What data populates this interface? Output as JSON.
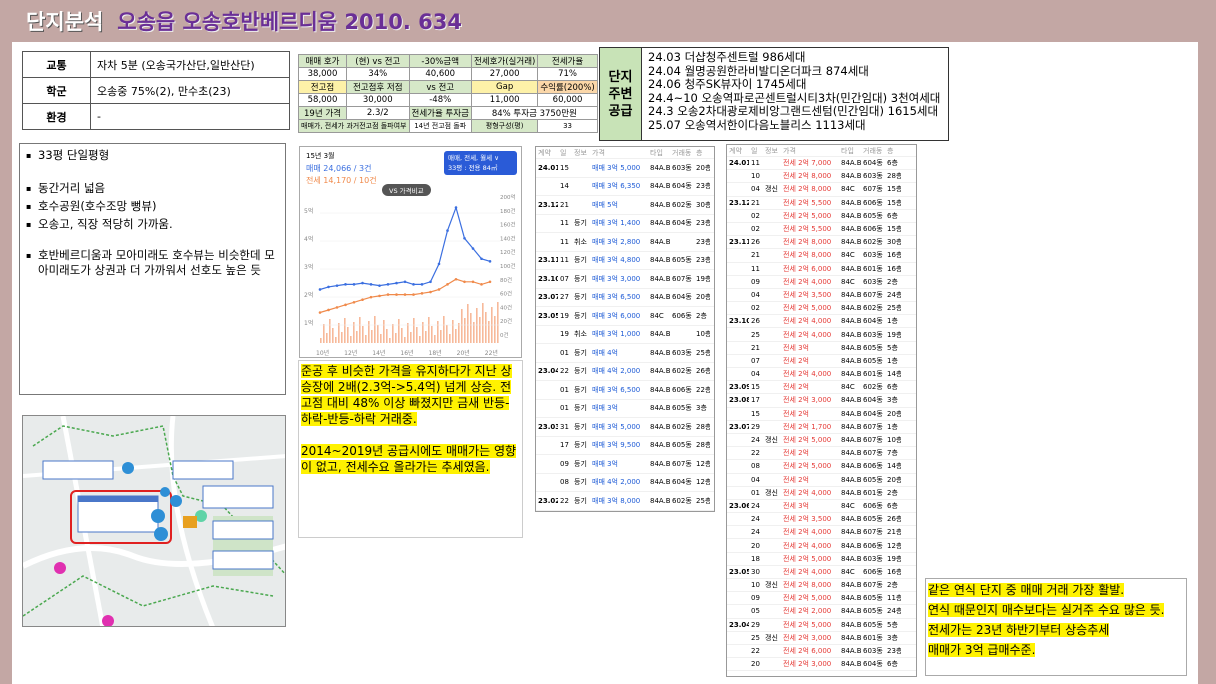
{
  "title": {
    "main": "단지분석",
    "sub": "오송읍 오송호반베르디움 2010. 634"
  },
  "info": [
    {
      "key": "교통",
      "value": "자차 5분 (오송국가산단,일반산단)"
    },
    {
      "key": "학군",
      "value": "오송중 75%(2), 만수초(23)"
    },
    {
      "key": "환경",
      "value": "-"
    }
  ],
  "price_table": {
    "r1": [
      "매매 호가",
      "(현) vs 전고",
      "-30%금액",
      "전세호가(실거래)",
      "전세가율"
    ],
    "r2": [
      "38,000",
      "34%",
      "40,600",
      "27,000",
      "71%"
    ],
    "r3": [
      "전고점",
      "전고점후 저점",
      "vs 전고",
      "Gap",
      "수익률(200%)"
    ],
    "r4": [
      "58,000",
      "30,000",
      "-48%",
      "11,000",
      "60,000"
    ],
    "r5": [
      "19년 가격",
      "2.3/2",
      "전세가율 투자금",
      "84% 투자금 3750만원"
    ],
    "r6": [
      "매매가, 전세가 과거전고점 돌파여부",
      "14년 전고점 돌파",
      "평형구성(평)",
      "33"
    ]
  },
  "supply": {
    "head": [
      "단지",
      "주변",
      "공급"
    ],
    "items": [
      "24.03 더샵청주센트럴 986세대",
      "24.04 월명공원한라비발디온더파크 874세대",
      "24.06 청주SK뷰자이 1745세대",
      "24.4~10 오송역파로곤센트럴시티3차(민간임대) 3천여세대",
      "24.3 오송2차대광로제비앙그랜드센텀(민간임대) 1615세대",
      "25.07 오송역서한이다음노블리스 1113세대"
    ]
  },
  "notes": [
    "33평 단일평형",
    "동간거리 넓음",
    "호수공원(호수조망 뻥뷰)",
    "오송고, 직장 적당히 가까움.",
    "호반베르디움과 모아미래도 호수뷰는 비슷한데 모아미래도가 상권과 더 가까워서 선호도 높은 듯"
  ],
  "chart": {
    "date": "15년 3월",
    "sale": "매매 24,066 / 3건",
    "jeonse": "전세 14,170 / 10건",
    "filter": "매매, 전세, 월세 ∨",
    "filter2": "33평 : 전용 84㎡",
    "compare": "VS 가격비교"
  },
  "chart_data": {
    "type": "line",
    "title": "",
    "x_ticks": [
      "10년",
      "12년",
      "14년",
      "16년",
      "18년",
      "20년",
      "22년"
    ],
    "y_left_ticks": [
      "5억",
      "4억",
      "3억",
      "2억",
      "1억"
    ],
    "y_right_ticks": [
      "200억",
      "180건",
      "160건",
      "140건",
      "120건",
      "100건",
      "80건",
      "60건",
      "40건",
      "20건",
      "0건"
    ],
    "series": [
      {
        "name": "매매",
        "color": "#3b6fe0",
        "values": [
          2.2,
          2.3,
          2.35,
          2.4,
          2.4,
          2.45,
          2.4,
          2.35,
          2.4,
          2.45,
          2.5,
          2.4,
          2.4,
          2.5,
          3.2,
          4.5,
          5.4,
          4.2,
          3.8,
          3.4,
          3.3
        ]
      },
      {
        "name": "전세",
        "color": "#f08a4b",
        "values": [
          1.3,
          1.4,
          1.5,
          1.6,
          1.7,
          1.8,
          1.9,
          1.95,
          2.0,
          2.0,
          2.0,
          2.0,
          2.05,
          2.1,
          2.2,
          2.4,
          2.6,
          2.5,
          2.5,
          2.4,
          2.5
        ]
      }
    ]
  },
  "commentary": [
    "준공 후 비슷한 가격을 유지하다가 지난 상승장에 2배(2.3억->5.4억) 넘게 상승. 전고점 대비 48% 이상 빠졌지만 금새 반등-하락-반등-하락 거래중.",
    "2014~2019년 공급시에도 매매가는 영향이 없고, 전세수요 올라가는 추세였음."
  ],
  "trades1": {
    "header": [
      "계약",
      "일",
      "정보",
      "가격",
      "타입",
      "거래동",
      "층"
    ],
    "rows": [
      [
        "24.01",
        "15",
        "",
        "매매 3억 5,000",
        "84A.B",
        "603동",
        "20층"
      ],
      [
        "",
        "14",
        "",
        "매매 3억 6,350",
        "84A.B",
        "604동",
        "23층"
      ],
      [
        "23.12",
        "21",
        "",
        "매매 5억",
        "84A.B",
        "602동",
        "30층"
      ],
      [
        "",
        "11",
        "등기",
        "매매 3억 1,400",
        "84A.B",
        "604동",
        "23층"
      ],
      [
        "",
        "11",
        "취소",
        "매매 3억 2,800",
        "84A.B",
        "",
        "23층"
      ],
      [
        "23.11",
        "11",
        "등기",
        "매매 3억 4,800",
        "84A.B",
        "605동",
        "23층"
      ],
      [
        "23.10",
        "07",
        "등기",
        "매매 3억 3,000",
        "84A.B",
        "607동",
        "19층"
      ],
      [
        "23.07",
        "27",
        "등기",
        "매매 3억 6,500",
        "84A.B",
        "604동",
        "20층"
      ],
      [
        "23.05",
        "19",
        "등기",
        "매매 3억 6,000",
        "84C",
        "606동",
        "2층"
      ],
      [
        "",
        "19",
        "취소",
        "매매 3억 1,000",
        "84A.B",
        "",
        "10층"
      ],
      [
        "",
        "01",
        "등기",
        "매매 4억",
        "84A.B",
        "603동",
        "25층"
      ],
      [
        "23.04",
        "22",
        "등기",
        "매매 4억 2,000",
        "84A.B",
        "602동",
        "26층"
      ],
      [
        "",
        "01",
        "등기",
        "매매 3억 6,500",
        "84A.B",
        "606동",
        "22층"
      ],
      [
        "",
        "01",
        "등기",
        "매매 3억",
        "84A.B",
        "605동",
        "3층"
      ],
      [
        "23.03",
        "31",
        "등기",
        "매매 3억 5,000",
        "84A.B",
        "602동",
        "28층"
      ],
      [
        "",
        "17",
        "등기",
        "매매 3억 9,500",
        "84A.B",
        "605동",
        "28층"
      ],
      [
        "",
        "09",
        "등기",
        "매매 3억",
        "84A.B",
        "607동",
        "12층"
      ],
      [
        "",
        "08",
        "등기",
        "매매 4억 2,000",
        "84A.B",
        "604동",
        "12층"
      ],
      [
        "23.02",
        "22",
        "등기",
        "매매 3억 8,000",
        "84A.B",
        "602동",
        "25층"
      ]
    ]
  },
  "trades2": {
    "header": [
      "계약",
      "일",
      "정보",
      "가격",
      "타입",
      "거래동",
      "층"
    ],
    "rows": [
      [
        "24.01",
        "11",
        "",
        "전세 2억 7,000",
        "84A.B",
        "604동",
        "6층"
      ],
      [
        "",
        "10",
        "",
        "전세 2억 8,000",
        "84A.B",
        "603동",
        "28층"
      ],
      [
        "",
        "04",
        "갱신",
        "전세 2억 8,000",
        "84C",
        "607동",
        "15층"
      ],
      [
        "23.12",
        "21",
        "",
        "전세 2억 5,500",
        "84A.B",
        "606동",
        "15층"
      ],
      [
        "",
        "02",
        "",
        "전세 2억 5,000",
        "84A.B",
        "605동",
        "6층"
      ],
      [
        "",
        "02",
        "",
        "전세 2억 5,500",
        "84A.B",
        "606동",
        "15층"
      ],
      [
        "23.11",
        "26",
        "",
        "전세 2억 8,000",
        "84A.B",
        "602동",
        "30층"
      ],
      [
        "",
        "21",
        "",
        "전세 2억 8,000",
        "84C",
        "603동",
        "16층"
      ],
      [
        "",
        "11",
        "",
        "전세 2억 6,000",
        "84A.B",
        "601동",
        "16층"
      ],
      [
        "",
        "09",
        "",
        "전세 2억 4,000",
        "84C",
        "603동",
        "2층"
      ],
      [
        "",
        "04",
        "",
        "전세 2억 3,500",
        "84A.B",
        "607동",
        "24층"
      ],
      [
        "",
        "02",
        "",
        "전세 2억 5,000",
        "84A.B",
        "602동",
        "25층"
      ],
      [
        "23.10",
        "26",
        "",
        "전세 2억 4,000",
        "84A.B",
        "604동",
        "1층"
      ],
      [
        "",
        "25",
        "",
        "전세 2억 4,000",
        "84A.B",
        "603동",
        "19층"
      ],
      [
        "",
        "21",
        "",
        "전세 3억",
        "84A.B",
        "605동",
        "5층"
      ],
      [
        "",
        "07",
        "",
        "전세 2억",
        "84A.B",
        "605동",
        "1층"
      ],
      [
        "",
        "04",
        "",
        "전세 2억 4,000",
        "84A.B",
        "601동",
        "14층"
      ],
      [
        "23.09",
        "15",
        "",
        "전세 2억",
        "84C",
        "602동",
        "6층"
      ],
      [
        "23.08",
        "17",
        "",
        "전세 2억 3,000",
        "84A.B",
        "604동",
        "3층"
      ],
      [
        "",
        "15",
        "",
        "전세 2억",
        "84A.B",
        "604동",
        "20층"
      ],
      [
        "23.07",
        "29",
        "",
        "전세 2억 1,700",
        "84A.B",
        "607동",
        "1층"
      ],
      [
        "",
        "24",
        "갱신",
        "전세 2억 5,000",
        "84A.B",
        "607동",
        "10층"
      ],
      [
        "",
        "22",
        "",
        "전세 2억",
        "84A.B",
        "607동",
        "7층"
      ],
      [
        "",
        "08",
        "",
        "전세 2억 5,000",
        "84A.B",
        "606동",
        "14층"
      ],
      [
        "",
        "04",
        "",
        "전세 2억",
        "84A.B",
        "605동",
        "20층"
      ],
      [
        "",
        "01",
        "갱신",
        "전세 2억 4,000",
        "84A.B",
        "601동",
        "2층"
      ],
      [
        "23.06",
        "24",
        "",
        "전세 3억",
        "84C",
        "606동",
        "6층"
      ],
      [
        "",
        "24",
        "",
        "전세 2억 3,500",
        "84A.B",
        "605동",
        "26층"
      ],
      [
        "",
        "24",
        "",
        "전세 2억 4,000",
        "84A.B",
        "607동",
        "21층"
      ],
      [
        "",
        "20",
        "",
        "전세 2억 4,000",
        "84A.B",
        "606동",
        "12층"
      ],
      [
        "",
        "18",
        "",
        "전세 2억 5,000",
        "84A.B",
        "603동",
        "19층"
      ],
      [
        "23.05",
        "30",
        "",
        "전세 2억 4,000",
        "84C",
        "606동",
        "16층"
      ],
      [
        "",
        "10",
        "갱신",
        "전세 2억 8,000",
        "84A.B",
        "607동",
        "2층"
      ],
      [
        "",
        "09",
        "",
        "전세 2억 5,000",
        "84A.B",
        "605동",
        "11층"
      ],
      [
        "",
        "05",
        "",
        "전세 2억 2,000",
        "84A.B",
        "605동",
        "24층"
      ],
      [
        "23.04",
        "29",
        "",
        "전세 2억 5,000",
        "84A.B",
        "605동",
        "5층"
      ],
      [
        "",
        "25",
        "갱신",
        "전세 2억 3,000",
        "84A.B",
        "601동",
        "3층"
      ],
      [
        "",
        "22",
        "",
        "전세 2억 6,000",
        "84A.B",
        "603동",
        "23층"
      ],
      [
        "",
        "20",
        "",
        "전세 2억 3,000",
        "84A.B",
        "604동",
        "6층"
      ]
    ]
  },
  "bottom_note": [
    "같은 연식 단지 중 매매 거래 가장 활발.",
    "연식 때문인지 매수보다는 실거주 수요 많은 듯.",
    "전세가는 23년 하반기부터 상승추세",
    "매매가 3억 급매수준."
  ]
}
